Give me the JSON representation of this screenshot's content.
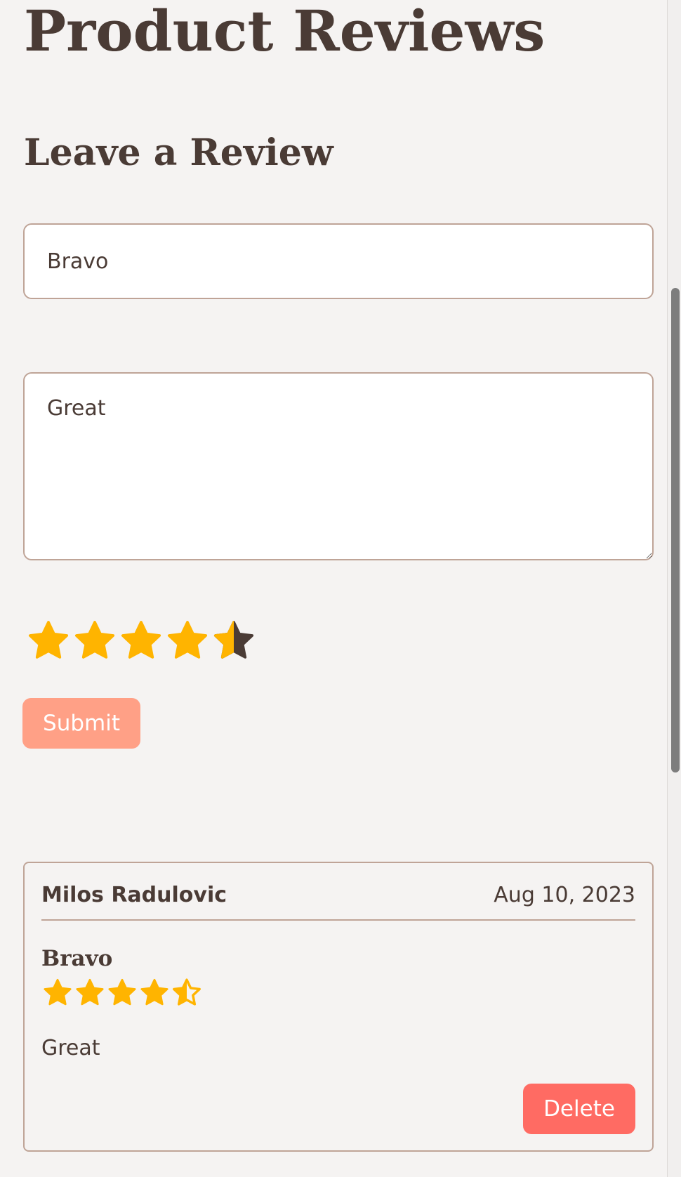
{
  "page": {
    "title": "Product Reviews"
  },
  "form": {
    "heading": "Leave a Review",
    "title_value": "Bravo",
    "body_value": "Great",
    "rating": 4.5,
    "rating_max": 5,
    "submit_label": "Submit"
  },
  "reviews": [
    {
      "author": "Milos Radulovic",
      "date": "Aug 10, 2023",
      "title": "Bravo",
      "rating": 4.5,
      "body": "Great",
      "delete_label": "Delete"
    }
  ],
  "colors": {
    "background": "#f5f3f2",
    "text": "#4a3b35",
    "border": "#bfa497",
    "star": "#ffb400",
    "star_empty": "#4a3b35",
    "submit": "#ffa086",
    "delete": "#ff6b63"
  },
  "icons": {
    "star": "star-icon",
    "half_star": "star-half-icon",
    "star_outline": "star-half-outline-icon"
  }
}
